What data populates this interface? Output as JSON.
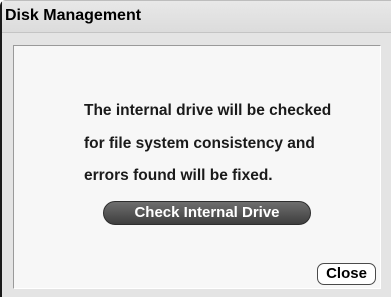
{
  "window": {
    "title": "Disk Management"
  },
  "dialog": {
    "message_lines": [
      "The internal drive will be checked",
      "for file system consistency and",
      "errors found will be fixed."
    ],
    "check_button_label": "Check Internal Drive",
    "close_button_label": "Close"
  },
  "colors": {
    "window_background": "#e4e4e4",
    "panel_background": "#f7f7f7",
    "primary_button": "#4e4e4e",
    "primary_button_text": "#ffffff",
    "secondary_button": "#ffffff"
  }
}
